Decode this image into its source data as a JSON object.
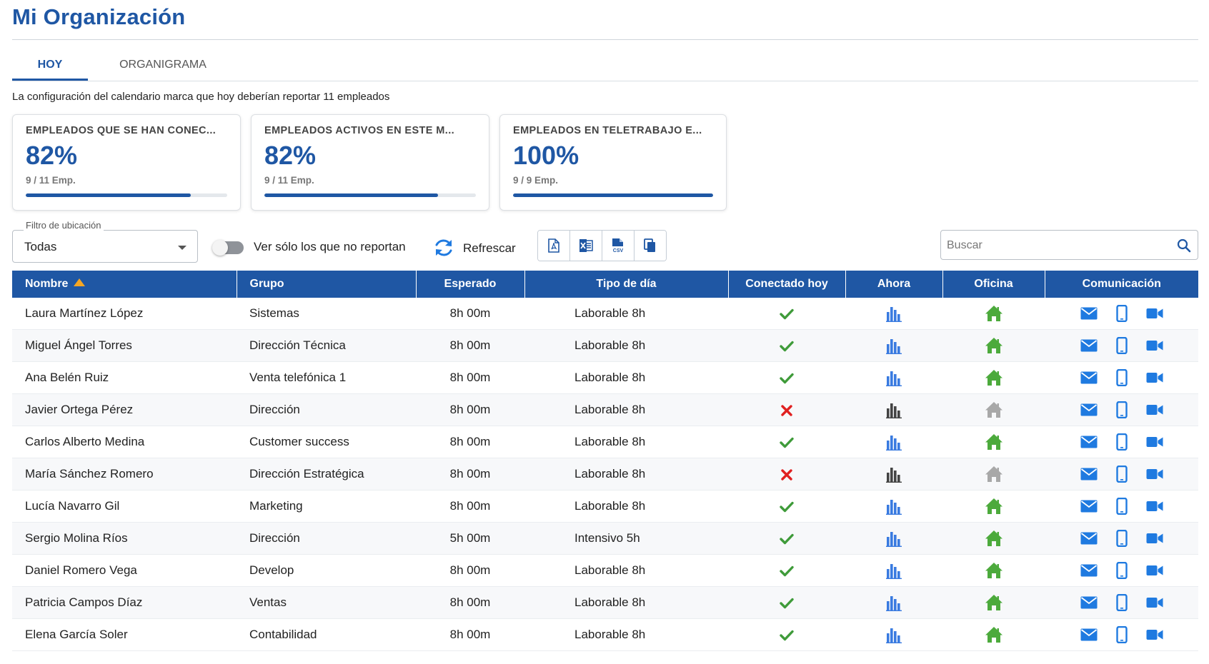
{
  "page": {
    "title": "Mi Organización",
    "tabs": [
      {
        "label": "HOY",
        "active": true
      },
      {
        "label": "ORGANIGRAMA",
        "active": false
      }
    ],
    "calendar_note": "La configuración del calendario marca que hoy deberían reportar 11 empleados"
  },
  "cards": [
    {
      "title": "EMPLEADOS QUE SE HAN CONEC...",
      "percent": "82%",
      "sub": "9 / 11 Emp.",
      "progress": 0.82
    },
    {
      "title": "EMPLEADOS ACTIVOS EN ESTE M...",
      "percent": "82%",
      "sub": "9 / 11 Emp.",
      "progress": 0.82
    },
    {
      "title": "EMPLEADOS EN TELETRABAJO E...",
      "percent": "100%",
      "sub": "9 / 9 Emp.",
      "progress": 1.0
    }
  ],
  "toolbar": {
    "filter_label": "Filtro de ubicación",
    "filter_value": "Todas",
    "toggle_label": "Ver sólo los que no reportan",
    "toggle_on": false,
    "refresh_label": "Refrescar",
    "export_buttons": [
      "pdf-export-icon",
      "excel-export-icon",
      "csv-export-icon",
      "copy-icon"
    ],
    "search_placeholder": "Buscar"
  },
  "table": {
    "columns": [
      "Nombre",
      "Grupo",
      "Esperado",
      "Tipo de día",
      "Conectado hoy",
      "Ahora",
      "Oficina",
      "Comunicación"
    ],
    "sort_column": "Nombre",
    "sort_direction": "asc",
    "rows": [
      {
        "nombre": "Laura Martínez López",
        "grupo": "Sistemas",
        "esperado": "8h 00m",
        "tipo": "Laborable 8h",
        "conectado": true
      },
      {
        "nombre": "Miguel Ángel Torres",
        "grupo": "Dirección Técnica",
        "esperado": "8h 00m",
        "tipo": "Laborable 8h",
        "conectado": true
      },
      {
        "nombre": "Ana Belén Ruiz",
        "grupo": "Venta telefónica 1",
        "esperado": "8h 00m",
        "tipo": "Laborable 8h",
        "conectado": true
      },
      {
        "nombre": "Javier Ortega Pérez",
        "grupo": "Dirección",
        "esperado": "8h 00m",
        "tipo": "Laborable 8h",
        "conectado": false
      },
      {
        "nombre": "Carlos Alberto Medina",
        "grupo": "Customer success",
        "esperado": "8h 00m",
        "tipo": "Laborable 8h",
        "conectado": true
      },
      {
        "nombre": "María Sánchez Romero",
        "grupo": "Dirección Estratégica",
        "esperado": "8h 00m",
        "tipo": "Laborable 8h",
        "conectado": false
      },
      {
        "nombre": "Lucía Navarro Gil",
        "grupo": "Marketing",
        "esperado": "8h 00m",
        "tipo": "Laborable 8h",
        "conectado": true
      },
      {
        "nombre": "Sergio Molina Ríos",
        "grupo": "Dirección",
        "esperado": "5h 00m",
        "tipo": "Intensivo 5h",
        "conectado": true
      },
      {
        "nombre": "Daniel Romero Vega",
        "grupo": "Develop",
        "esperado": "8h 00m",
        "tipo": "Laborable 8h",
        "conectado": true
      },
      {
        "nombre": "Patricia Campos Díaz",
        "grupo": "Ventas",
        "esperado": "8h 00m",
        "tipo": "Laborable 8h",
        "conectado": true
      },
      {
        "nombre": "Elena García Soler",
        "grupo": "Contabilidad",
        "esperado": "8h 00m",
        "tipo": "Laborable 8h",
        "conectado": true
      }
    ]
  },
  "colors": {
    "brand": "#1f57a4",
    "check": "#3f9b3a",
    "cross": "#e02020",
    "house_active": "#4caa3c",
    "house_inactive": "#a8a8a8",
    "bars_active": "#3a7be0",
    "bars_inactive": "#444444",
    "comm_icons": "#1f7ae0",
    "sort_arrow": "#f5a623"
  }
}
